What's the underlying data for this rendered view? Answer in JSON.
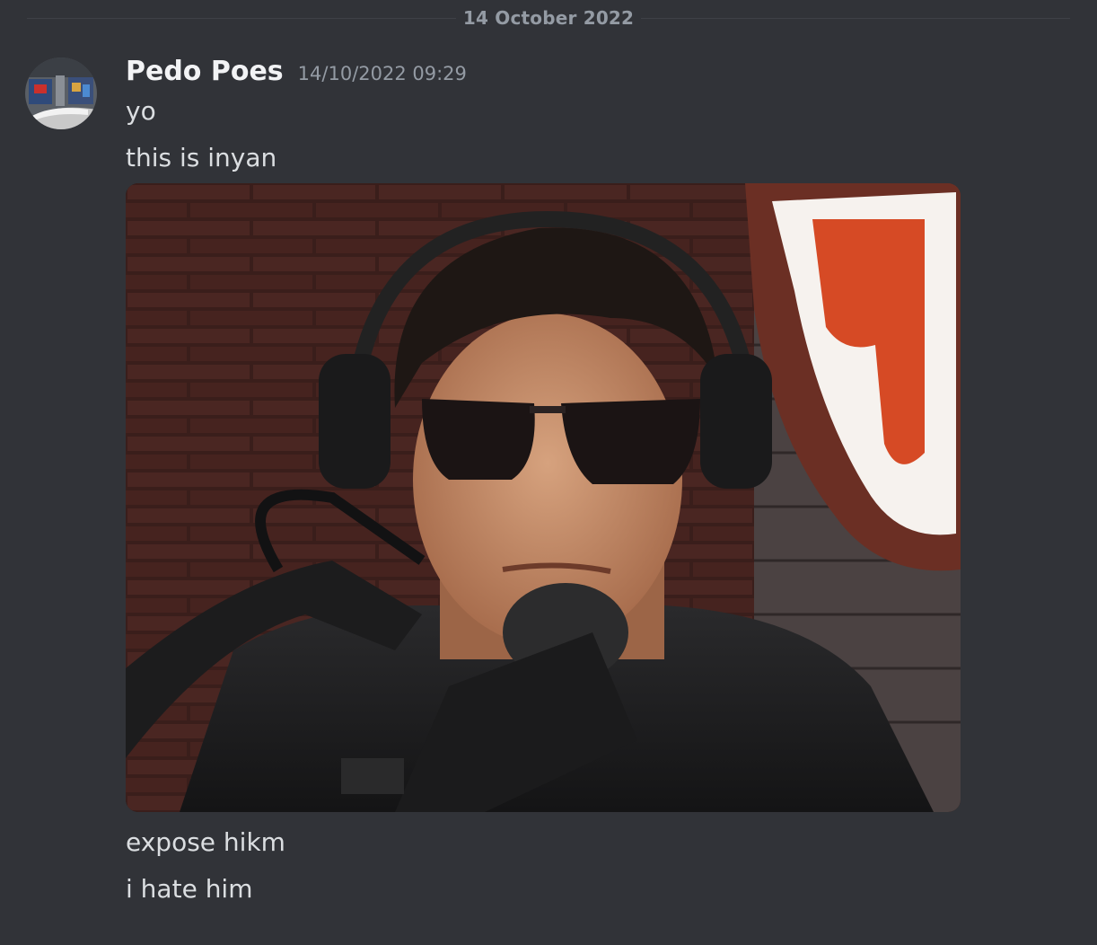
{
  "divider": {
    "date": "14 October 2022"
  },
  "message": {
    "username": "Pedo Poes",
    "timestamp": "14/10/2022 09:29",
    "lines_before": [
      "yo",
      "this is inyan"
    ],
    "lines_after": [
      "expose hikm",
      "i hate him"
    ]
  },
  "icons": {
    "avatar": "user-avatar-photo",
    "attachment": "image-attachment"
  },
  "colors": {
    "background": "#313338",
    "username": "#f2f3f5",
    "text": "#dbdee1",
    "muted": "#949ba4"
  }
}
